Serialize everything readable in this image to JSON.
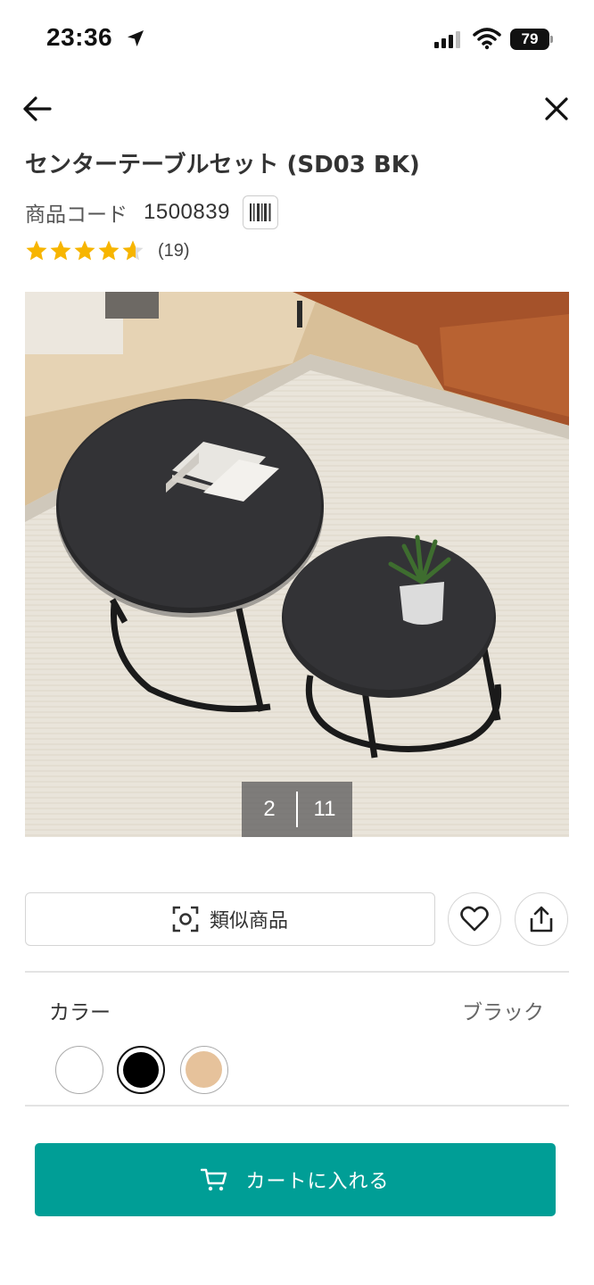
{
  "status_bar": {
    "time": "23:36",
    "battery": "79"
  },
  "product": {
    "title": "センターテーブルセット (SD03 BK)",
    "code_label": "商品コード",
    "code_value": "1500839",
    "rating": 4.5,
    "review_count": "(19)"
  },
  "gallery": {
    "current": "2",
    "total": "11"
  },
  "actions": {
    "similar_label": "類似商品"
  },
  "color": {
    "label": "カラー",
    "selected": "ブラック",
    "swatches": [
      "#ffffff",
      "#000000",
      "#e6c29b"
    ]
  },
  "cart": {
    "label": "カートに入れる"
  },
  "colors": {
    "accent": "#009e96",
    "star": "#f7b500"
  }
}
